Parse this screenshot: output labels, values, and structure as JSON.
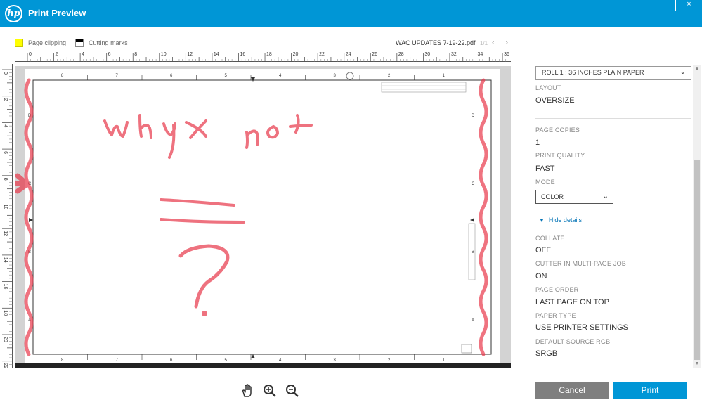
{
  "window": {
    "title": "Print Preview",
    "logo": "hp",
    "close_label": "×"
  },
  "legend": {
    "page_clipping": "Page clipping",
    "cutting_marks": "Cutting marks"
  },
  "document": {
    "name": "WAC UPDATES 7-19-22.pdf",
    "page_count": "1/1",
    "prev": "‹",
    "next": "›"
  },
  "ruler_top_labels": [
    "0",
    "2",
    "4",
    "6",
    "8",
    "10",
    "12",
    "14",
    "16",
    "18",
    "20",
    "22",
    "24",
    "26",
    "28",
    "30",
    "32",
    "34",
    "36"
  ],
  "ruler_left_labels": [
    "0",
    "2",
    "4",
    "6",
    "8",
    "10",
    "12",
    "14",
    "16",
    "18",
    "20",
    "22"
  ],
  "drawing": {
    "column_labels": [
      "8",
      "7",
      "6",
      "5",
      "4",
      "3",
      "2",
      "1"
    ],
    "row_labels": [
      "D",
      "C",
      "B",
      "A"
    ]
  },
  "tools": {
    "pan": "hand-icon",
    "zoom_in": "zoom-in-icon",
    "zoom_out": "zoom-out-icon"
  },
  "settings": {
    "roll": "ROLL 1 : 36 INCHES PLAIN PAPER",
    "layout_label": "LAYOUT",
    "layout_value": "OVERSIZE",
    "copies_label": "PAGE COPIES",
    "copies_value": "1",
    "quality_label": "PRINT QUALITY",
    "quality_value": "FAST",
    "mode_label": "MODE",
    "mode_value": "COLOR",
    "hide_details": "Hide details",
    "collate_label": "COLLATE",
    "collate_value": "OFF",
    "cutter_label": "CUTTER IN MULTI-PAGE JOB",
    "cutter_value": "ON",
    "order_label": "PAGE ORDER",
    "order_value": "LAST PAGE ON TOP",
    "paper_label": "PAPER TYPE",
    "paper_value": "USE PRINTER SETTINGS",
    "rgb_label": "DEFAULT SOURCE RGB",
    "rgb_value": "SRGB"
  },
  "buttons": {
    "cancel": "Cancel",
    "print": "Print"
  },
  "colors": {
    "accent": "#0096d6",
    "cancel": "#7f7f7f",
    "ink": "#e8374a"
  }
}
